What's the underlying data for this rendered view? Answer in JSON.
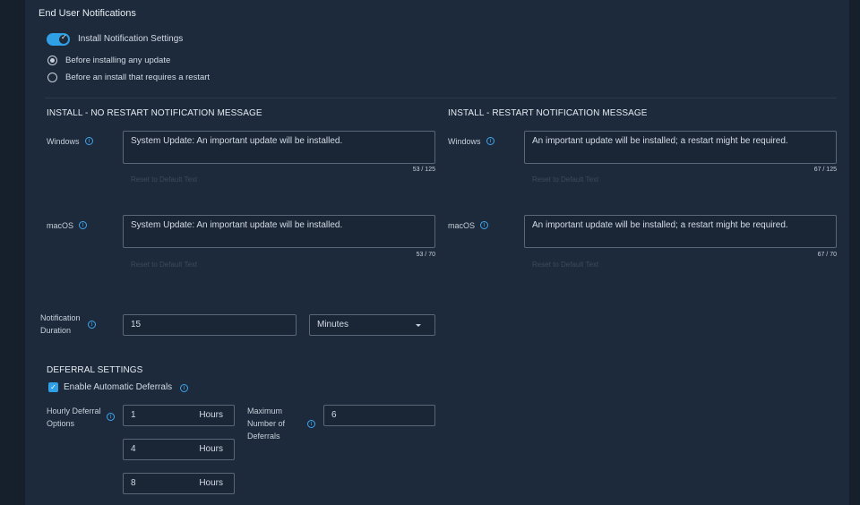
{
  "section_title": "End User Notifications",
  "install_toggle": {
    "label": "Install Notification Settings",
    "on": true
  },
  "timing": {
    "options": [
      "Before installing any update",
      "Before an install that requires a restart"
    ],
    "selected": 0
  },
  "no_restart": {
    "heading": "INSTALL - NO RESTART NOTIFICATION MESSAGE",
    "windows": {
      "label": "Windows",
      "value": "System Update: An important update will be installed.",
      "count": "53 / 125",
      "reset": "Reset to Default Text"
    },
    "macos": {
      "label": "macOS",
      "value": "System Update: An important update will be installed.",
      "count": "53 / 70",
      "reset": "Reset to Default Text"
    }
  },
  "restart": {
    "heading": "INSTALL - RESTART NOTIFICATION MESSAGE",
    "windows": {
      "label": "Windows",
      "value": "An important update will be installed; a restart might be required.",
      "count": "67 / 125",
      "reset": "Reset to Default Text"
    },
    "macos": {
      "label": "macOS",
      "value": "An important update will be installed; a restart might be required.",
      "count": "67 / 70",
      "reset": "Reset to Default Text"
    }
  },
  "duration": {
    "label_line1": "Notification",
    "label_line2": "Duration",
    "value": "15",
    "unit": "Minutes"
  },
  "deferral": {
    "heading": "DEFERRAL SETTINGS",
    "enable_label": "Enable Automatic Deferrals",
    "enabled": true,
    "hourly_label_line1": "Hourly Deferral",
    "hourly_label_line2": "Options",
    "hourly_options": [
      {
        "value": "1",
        "suffix": "Hours"
      },
      {
        "value": "4",
        "suffix": "Hours"
      },
      {
        "value": "8",
        "suffix": "Hours"
      }
    ],
    "max_label_line1": "Maximum",
    "max_label_line2": "Number of",
    "max_label_line3": "Deferrals",
    "max_value": "6"
  },
  "icons": {
    "info": "info-icon",
    "check": "check-icon",
    "dropdown": "chevron-down-icon"
  },
  "colors": {
    "accent": "#2f9fe6",
    "panel": "#1d2a3b",
    "background": "#16202c"
  }
}
